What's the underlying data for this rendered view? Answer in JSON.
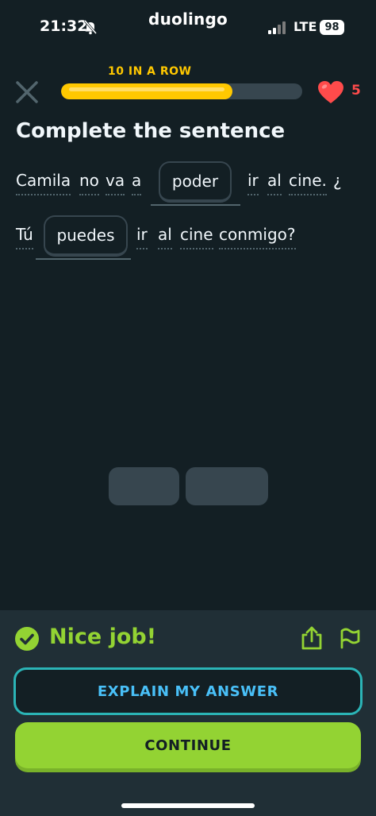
{
  "status_bar": {
    "time": "21:32",
    "app_name": "duolingo",
    "network": "LTE",
    "battery": "98"
  },
  "header": {
    "streak_label": "10 IN A ROW",
    "progress_fraction": 0.71,
    "hearts": "5"
  },
  "exercise": {
    "title": "Complete the sentence",
    "line1": {
      "w1": "Camila",
      "w2": "no",
      "w3": "va",
      "w4": "a",
      "answer": "poder",
      "w5": "ir",
      "w6": "al",
      "w7": "cine.",
      "w8": "¿"
    },
    "line2": {
      "w1": "Tú",
      "answer": "puedes",
      "w2": "ir",
      "w3": "al",
      "w4": "cine",
      "w5": "conmigo?"
    }
  },
  "feedback": {
    "message": "Nice job!",
    "explain_label": "EXPLAIN MY ANSWER",
    "continue_label": "CONTINUE"
  },
  "colors": {
    "background": "#131f24",
    "accent_yellow": "#ffc800",
    "success_green": "#93d333",
    "heart_red": "#ff4b4b",
    "explain_blue": "#49c0f8"
  },
  "icons": [
    "bell-slash-icon",
    "signal-icon",
    "close-icon",
    "heart-icon",
    "check-circle-icon",
    "share-icon",
    "flag-icon"
  ]
}
